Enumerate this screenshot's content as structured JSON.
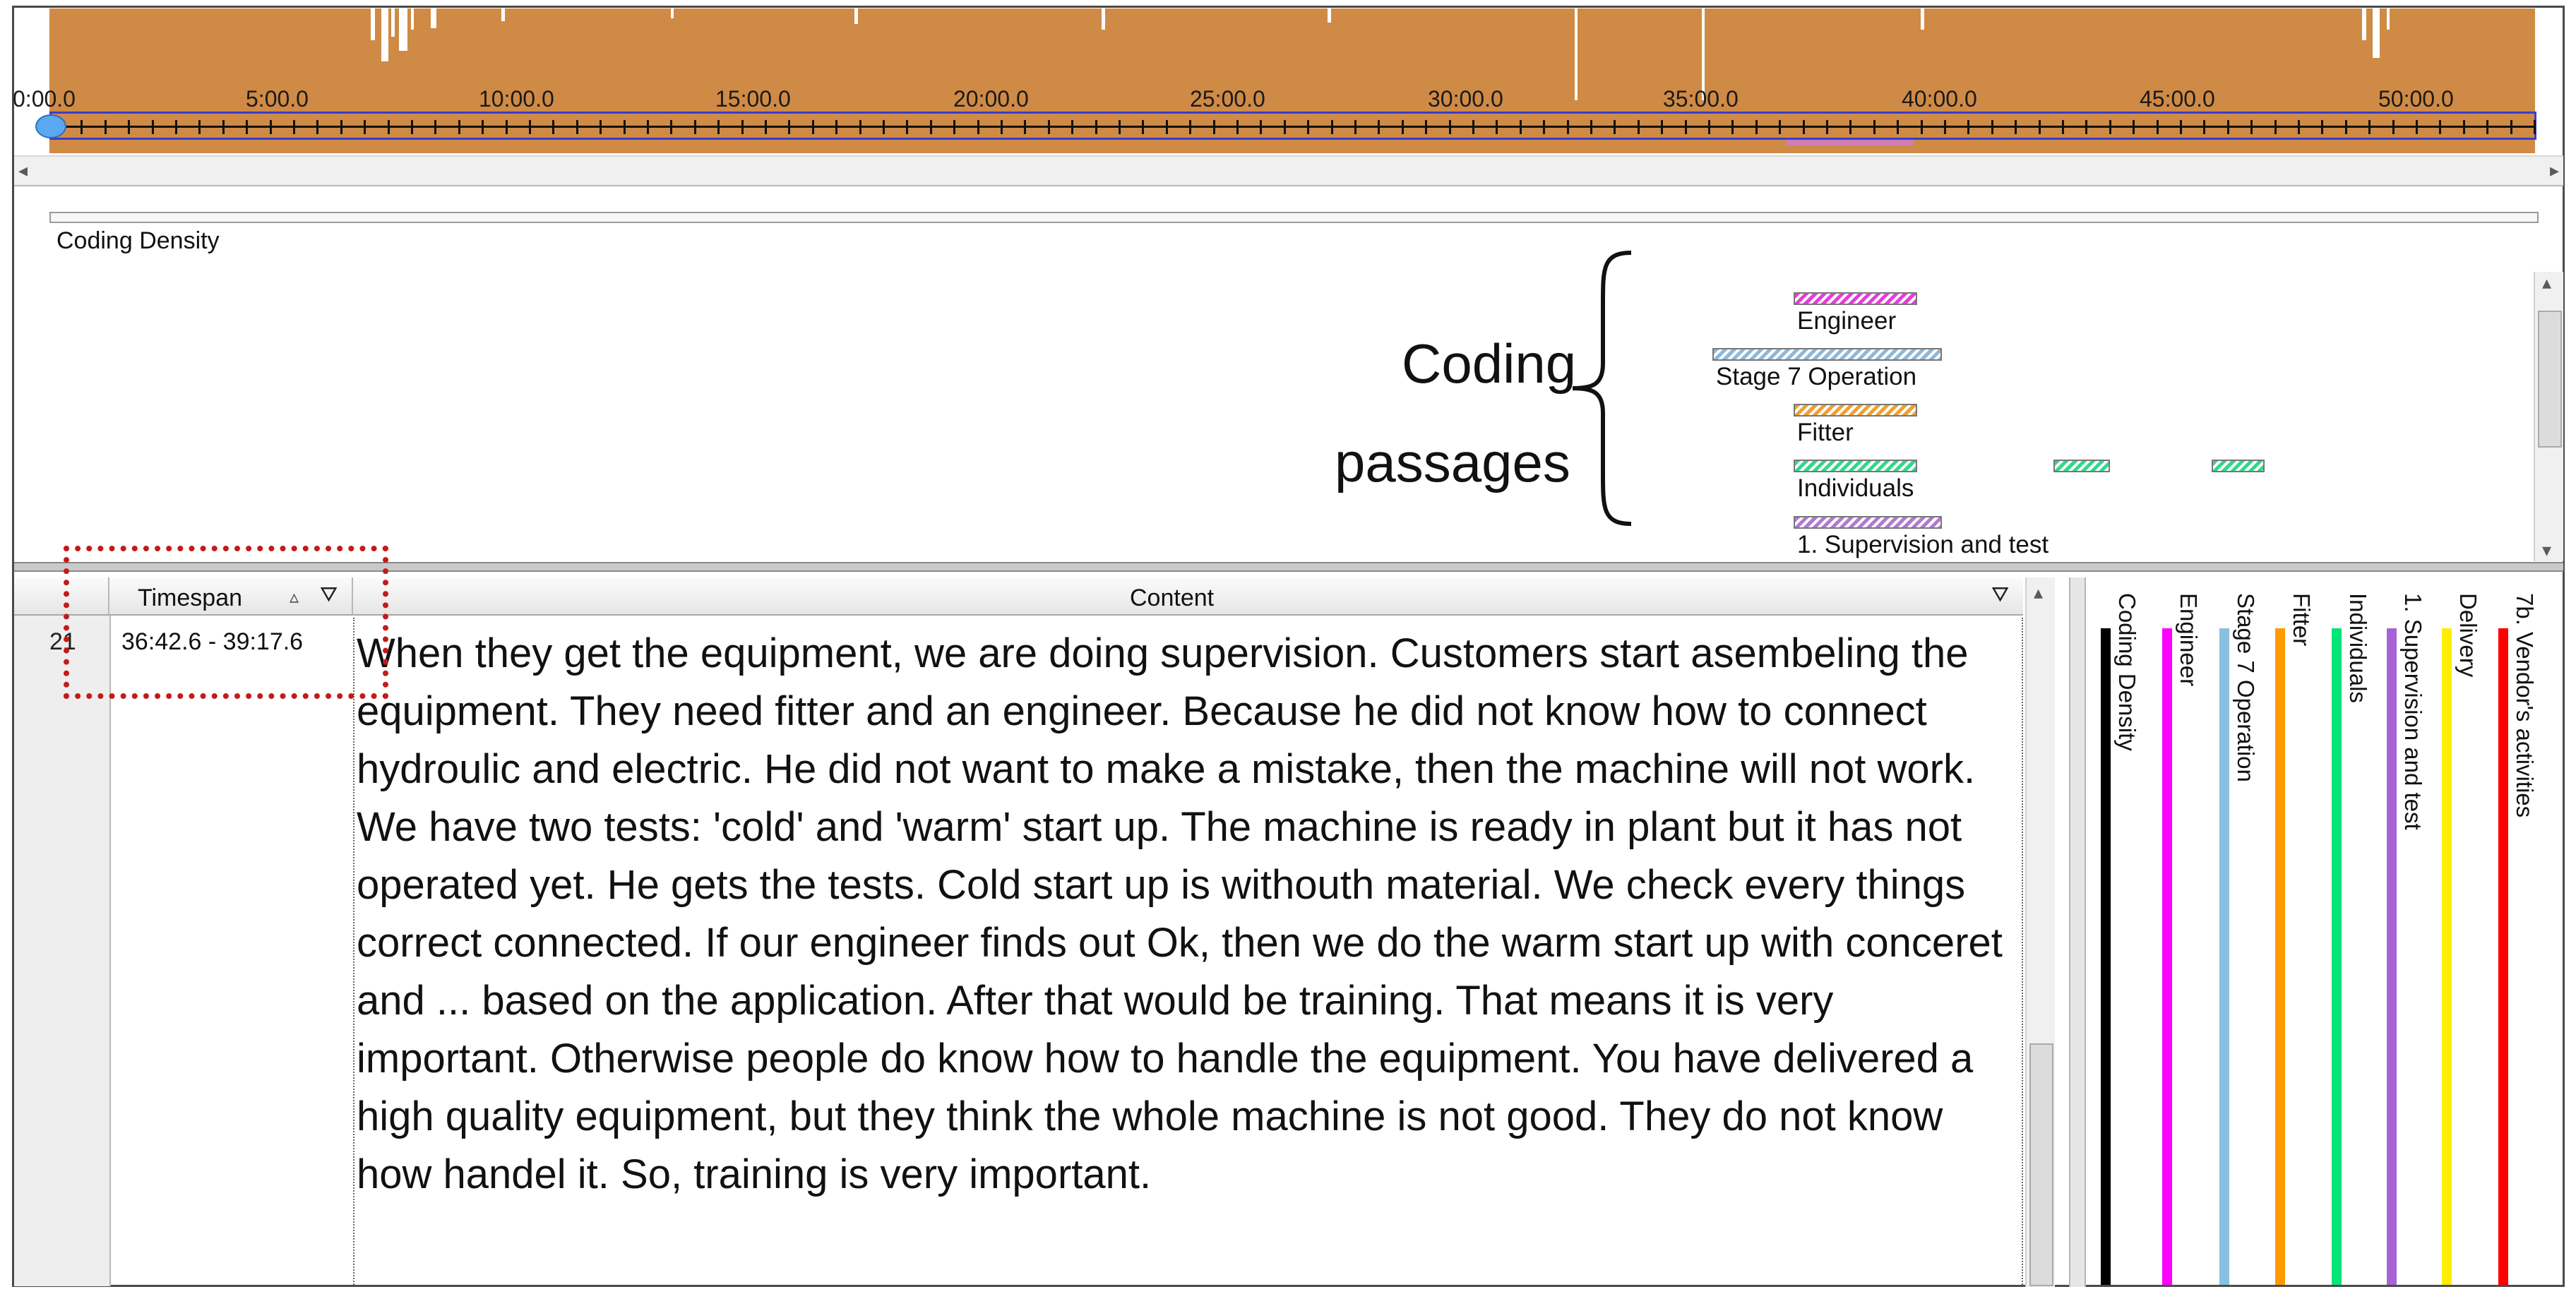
{
  "timeline": {
    "ticks": [
      "0:00.0",
      "5:00.0",
      "10:00.0",
      "15:00.0",
      "20:00.0",
      "25:00.0",
      "30:00.0",
      "35:00.0",
      "40:00.0",
      "45:00.0",
      "50:00.0"
    ]
  },
  "coding_density_label": "Coding Density",
  "annotation": {
    "line1": "Coding",
    "line2": "passages"
  },
  "stripes": [
    {
      "label": "Engineer",
      "color": "#e23fd8"
    },
    {
      "label": "Stage 7 Operation",
      "color": "#8fb8d8"
    },
    {
      "label": "Fitter",
      "color": "#f0a030"
    },
    {
      "label": "Individuals",
      "color": "#2fd98a"
    },
    {
      "label": "1. Supervision and test",
      "color": "#b07ad0"
    }
  ],
  "grid": {
    "columns": {
      "timespan": "Timespan",
      "content": "Content"
    },
    "row": {
      "number": "21",
      "timespan": "36:42.6 - 39:17.6",
      "content": "When they get the equipment, we are doing supervision.  Customers start asembeling the equipment.  They need fitter and an engineer.  Because he did not know how to connect hydroulic and electric.  He did not want to make a mistake, then the machine will not work.  We have two tests: 'cold' and 'warm' start up.  The machine is ready in plant but it has not operated yet.  He gets the tests.  Cold start up is withouth material.  We check every things correct connected.  If our engineer finds out Ok, then we do the warm start up with conceret and ... based on the application.  After that would be training.  That means it is very important.  Otherwise people do know how to handle the equipment.  You have delivered a high quality equipment, but they think the whole machine is not good.  They do not know how handel it.  So, training is very important."
    }
  },
  "legend": [
    {
      "label": "Coding Density",
      "color": "#000000"
    },
    {
      "label": "Engineer",
      "color": "#ff00ff"
    },
    {
      "label": "Stage 7 Operation",
      "color": "#88c0e0"
    },
    {
      "label": "Fitter",
      "color": "#ff9900"
    },
    {
      "label": "Individuals",
      "color": "#00e676"
    },
    {
      "label": "1. Supervision and test",
      "color": "#a763d6"
    },
    {
      "label": "Delivery",
      "color": "#ffee00"
    },
    {
      "label": "7b. Vendor's activities",
      "color": "#ff0000"
    }
  ]
}
